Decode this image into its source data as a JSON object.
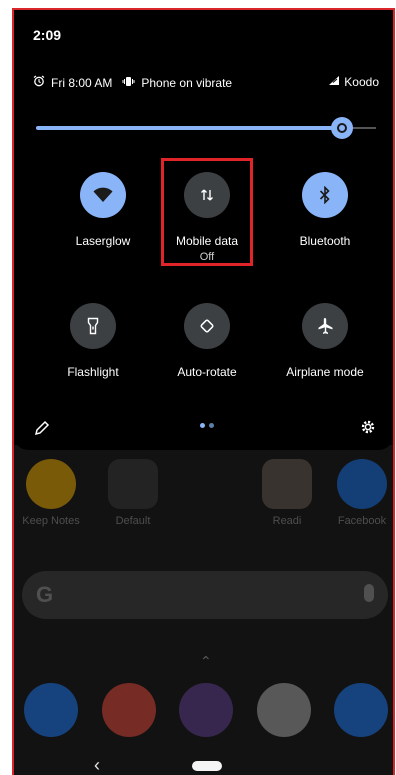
{
  "status": {
    "time": "2:09",
    "alarm_icon": "alarm-icon",
    "alarm": "Fri 8:00 AM",
    "vibrate_icon": "vibrate-icon",
    "vibrate": "Phone on vibrate",
    "signal_icon": "signal-icon",
    "carrier": "Koodo"
  },
  "brightness": {
    "level": 0.9
  },
  "tiles": [
    {
      "label": "Laserglow",
      "sub": "",
      "state": "on",
      "icon": "wifi-icon"
    },
    {
      "label": "Mobile data",
      "sub": "Off",
      "state": "off",
      "icon": "mobile-data-icon"
    },
    {
      "label": "Bluetooth",
      "sub": "",
      "state": "on",
      "icon": "bluetooth-icon"
    },
    {
      "label": "Flashlight",
      "sub": "",
      "state": "off",
      "icon": "flashlight-icon"
    },
    {
      "label": "Auto-rotate",
      "sub": "",
      "state": "off",
      "icon": "auto-rotate-icon"
    },
    {
      "label": "Airplane mode",
      "sub": "",
      "state": "off",
      "icon": "airplane-icon"
    }
  ],
  "footer": {
    "edit_icon": "pencil-icon",
    "settings_icon": "gear-icon",
    "page_indicator": "1 of 2"
  },
  "home": {
    "apps": [
      {
        "label": "Keep Notes"
      },
      {
        "label": "Default"
      },
      {
        "label": "Readi"
      },
      {
        "label": "Facebook"
      }
    ],
    "search_logo": "G",
    "nav_back": "‹"
  },
  "colors": {
    "accent": "#8ab4f8",
    "tile_off": "#3c4043",
    "highlight": "#e0242a"
  }
}
